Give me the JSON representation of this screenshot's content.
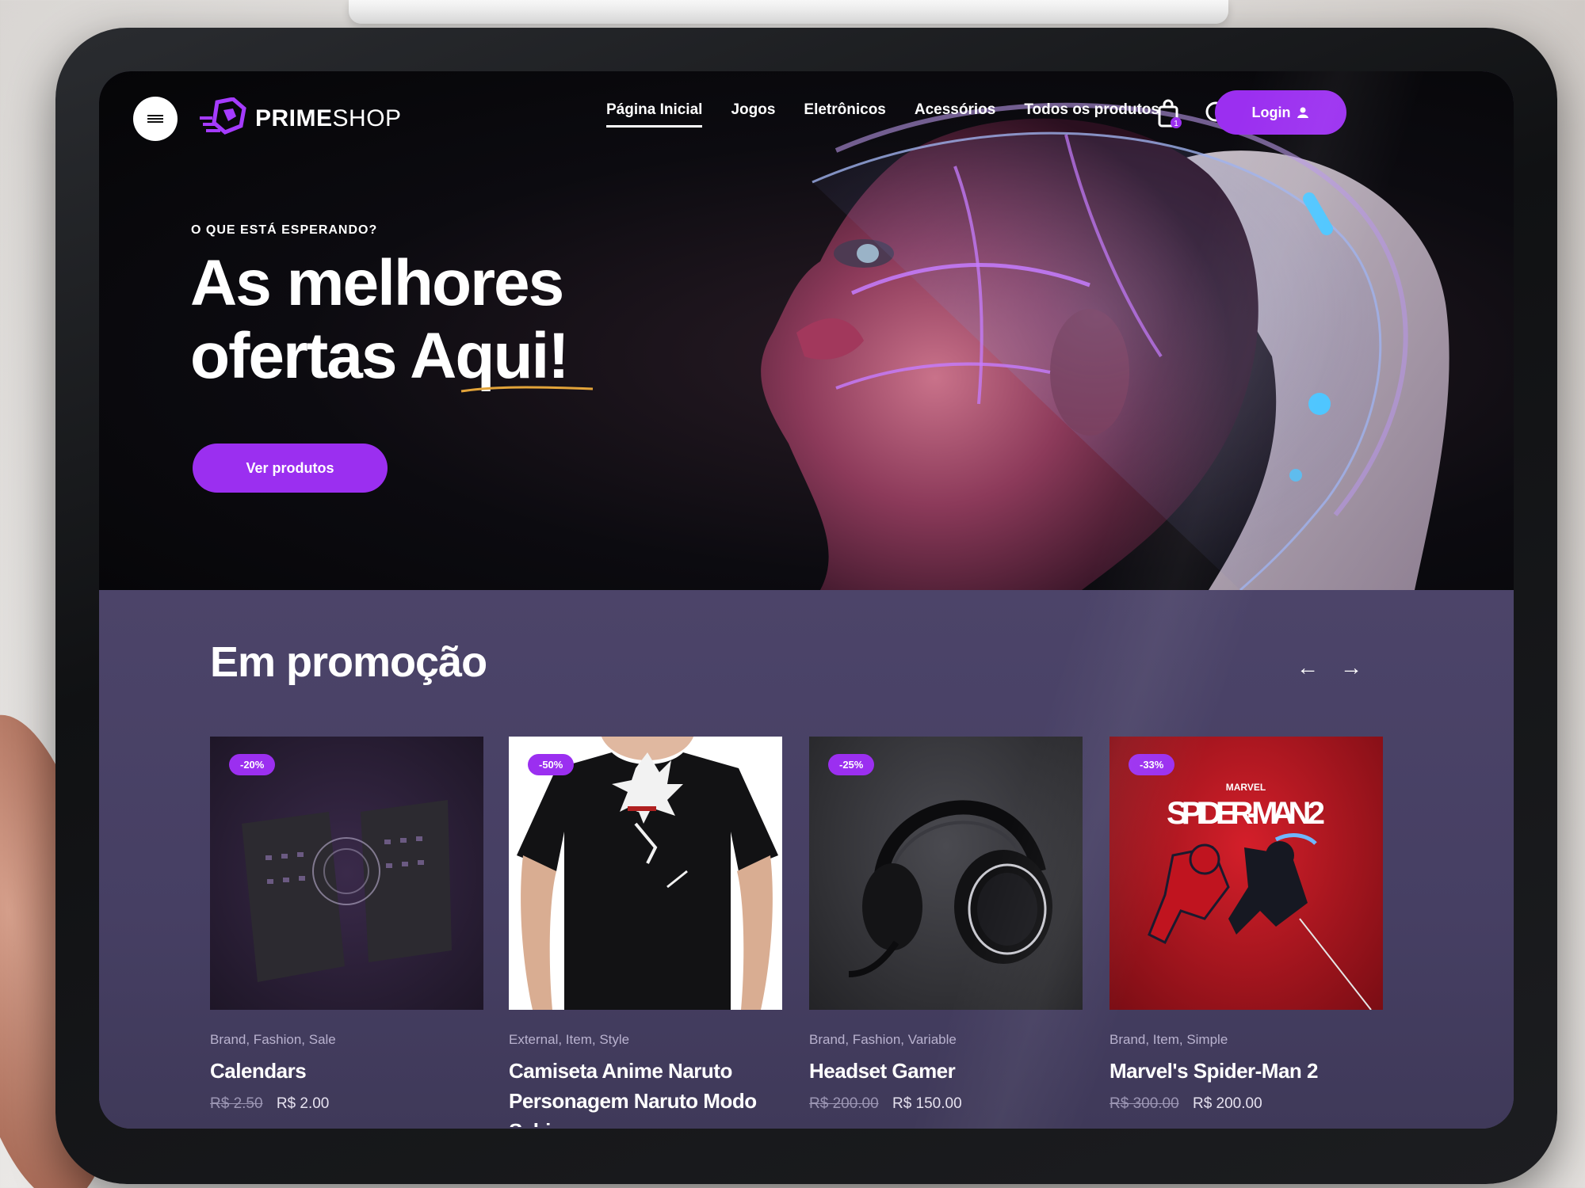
{
  "brand": {
    "logo_bold": "PRIME",
    "logo_light": "SHOP"
  },
  "nav": {
    "items": [
      {
        "label": "Página Inicial",
        "active": true
      },
      {
        "label": "Jogos",
        "active": false
      },
      {
        "label": "Eletrônicos",
        "active": false
      },
      {
        "label": "Acessórios",
        "active": false
      },
      {
        "label": "Todos os produtos",
        "active": false
      }
    ],
    "cart_count": "1",
    "login_label": "Login"
  },
  "hero": {
    "eyebrow": "O QUE ESTÁ ESPERANDO?",
    "headline_line1": "As melhores",
    "headline_line2": "ofertas Aqui!",
    "cta_label": "Ver produtos"
  },
  "promo": {
    "title": "Em promoção",
    "prev_label": "←",
    "next_label": "→",
    "products": [
      {
        "badge": "-20%",
        "categories": "Brand, Fashion, Sale",
        "name": "Calendars",
        "old_price": "R$ 2.50",
        "price": "R$ 2.00"
      },
      {
        "badge": "-50%",
        "categories": "External, Item, Style",
        "name": "Camiseta Anime Naruto Personagem Naruto Modo Sabio",
        "old_price": "",
        "price": ""
      },
      {
        "badge": "-25%",
        "categories": "Brand, Fashion, Variable",
        "name": "Headset Gamer",
        "old_price": "R$ 200.00",
        "price": "R$ 150.00"
      },
      {
        "badge": "-33%",
        "categories": "Brand, Item, Simple",
        "name": "Marvel's Spider-Man 2",
        "old_price": "R$ 300.00",
        "price": "R$ 200.00",
        "cover_brand": "MARVEL",
        "cover_title": "SPIDER-MAN 2"
      }
    ]
  },
  "colors": {
    "accent": "#9b2ff0",
    "hero_bg": "#050507",
    "promo_bg": "#4c4469"
  }
}
